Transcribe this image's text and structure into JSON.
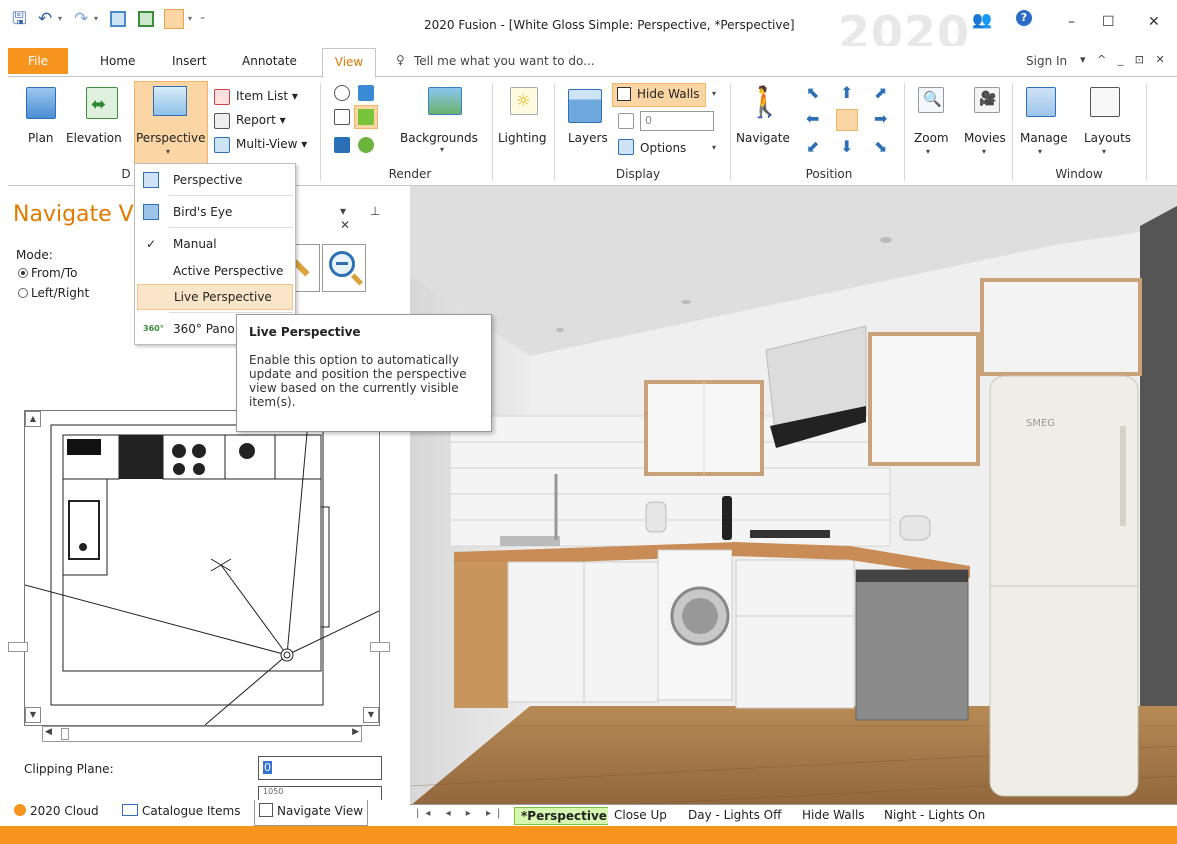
{
  "window": {
    "title": "2020 Fusion - [White Gloss Simple: Perspective, *Perspective]",
    "brand": "2020",
    "controls": {
      "minimize": "–",
      "maximize": "☐",
      "close": "✕"
    }
  },
  "quick_access": {
    "save_icon": "save-icon",
    "undo_icon": "undo-icon",
    "redo_icon": "redo-icon"
  },
  "tabs": {
    "file": "File",
    "home": "Home",
    "insert": "Insert",
    "annotate": "Annotate",
    "view": "View",
    "tell_me": "Tell me what you want to do...",
    "sign_in": "Sign In",
    "right_controls": "▾  ^  _  ⊡  ✕"
  },
  "ribbon": {
    "plan": "Plan",
    "elevation": "Elevation",
    "perspective": "Perspective",
    "item_list": "Item List",
    "report": "Report",
    "multi_view": "Multi-View",
    "views_group_initial": "D",
    "backgrounds": "Backgrounds",
    "render_group": "Render",
    "lighting": "Lighting",
    "layers": "Layers",
    "hide_walls": "Hide Walls",
    "layer_value": "0",
    "options": "Options",
    "display_group": "Display",
    "navigate": "Navigate",
    "position_group": "Position",
    "zoom": "Zoom",
    "movies": "Movies",
    "manage": "Manage",
    "layouts": "Layouts",
    "window_group": "Window"
  },
  "dropdown": {
    "items": [
      {
        "label": "Perspective",
        "icon": "perspective-icon"
      },
      {
        "label": "Bird's Eye",
        "icon": "birds-eye-icon"
      },
      {
        "label": "Manual",
        "checked": true
      },
      {
        "label": "Active Perspective"
      },
      {
        "label": "Live Perspective",
        "selected": true
      },
      {
        "label": "360° Pano",
        "icon": "pano-360-icon"
      }
    ]
  },
  "tooltip": {
    "title": "Live Perspective",
    "body": "Enable this option to automatically update and position the perspective view based on the currently visible item(s)."
  },
  "left_panel": {
    "title": "Navigate Vi",
    "mode_label": "Mode:",
    "mode_options": [
      "From/To",
      "Left/Right"
    ],
    "mode_selected": "From/To",
    "clipping_label": "Clipping Plane:",
    "clipping_value": "0",
    "clipping_value_2": "1050",
    "bottom_tabs": [
      "2020 Cloud",
      "Catalogue Items",
      "Navigate View"
    ]
  },
  "sheet_tabs": [
    "*Perspective",
    "Close Up",
    "Day - Lights Off",
    "Hide Walls",
    "Night - Lights On"
  ],
  "sheet_nav": [
    "|◂",
    "◂",
    "▸",
    "▸|",
    "⊕"
  ],
  "scene": {
    "fridge_brand": "SMEG"
  },
  "colors": {
    "accent": "#f7941d",
    "accent_text": "#e07b00",
    "highlight": "#fbd5a4"
  }
}
